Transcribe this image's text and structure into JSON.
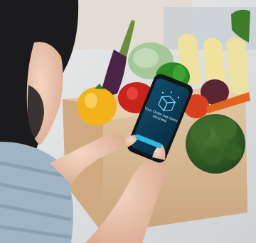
{
  "photo": {
    "subject": "Person holding smartphone in front of a cardboard box of fresh vegetables",
    "phone_screen": {
      "icon": "box-icon",
      "text": "Your Order has been received",
      "button_label": ""
    },
    "colors": {
      "background_wall": "#d9dadb",
      "box": "#d8b994",
      "shirt": "#9fb4c4",
      "hair": "#1b1a1d",
      "phone_screen": "#0f3e58",
      "accent_cyan": "#2fb8e6"
    }
  }
}
